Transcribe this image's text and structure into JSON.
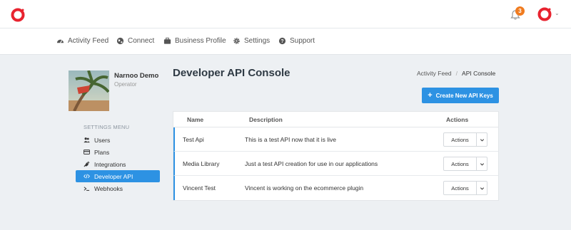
{
  "header": {
    "notification_count": "3",
    "brand_color": "#e8232f"
  },
  "nav": {
    "items": [
      {
        "label": "Activity Feed",
        "icon": "dashboard-icon"
      },
      {
        "label": "Connect",
        "icon": "globe-icon"
      },
      {
        "label": "Business Profile",
        "icon": "briefcase-icon"
      },
      {
        "label": "Settings",
        "icon": "gear-icon"
      },
      {
        "label": "Support",
        "icon": "question-circle-icon"
      }
    ]
  },
  "profile": {
    "name": "Narnoo Demo",
    "role": "Operator"
  },
  "settings_menu": {
    "title": "SETTINGS MENU",
    "items": [
      {
        "label": "Users",
        "icon": "users-icon",
        "active": false
      },
      {
        "label": "Plans",
        "icon": "credit-card-icon",
        "active": false
      },
      {
        "label": "Integrations",
        "icon": "plug-icon",
        "active": false
      },
      {
        "label": "Developer API",
        "icon": "code-icon",
        "active": true
      },
      {
        "label": "Webhooks",
        "icon": "terminal-icon",
        "active": false
      }
    ]
  },
  "page": {
    "title": "Developer API Console",
    "breadcrumb": {
      "parent": "Activity Feed",
      "separator": "/",
      "current": "API Console"
    },
    "create_button": "Create New API Keys"
  },
  "table": {
    "columns": {
      "name": "Name",
      "description": "Description",
      "actions": "Actions"
    },
    "rows": [
      {
        "name": "Test Api",
        "description": "This is a test API now that it is live",
        "action_label": "Actions"
      },
      {
        "name": "Media Library",
        "description": "Just a test API creation for use in our applications",
        "action_label": "Actions"
      },
      {
        "name": "Vincent Test",
        "description": "Vincent is working on the ecommerce plugin",
        "action_label": "Actions"
      }
    ]
  },
  "colors": {
    "accent": "#2d92e3",
    "badge": "#f07b1f",
    "background": "#edf0f3"
  }
}
